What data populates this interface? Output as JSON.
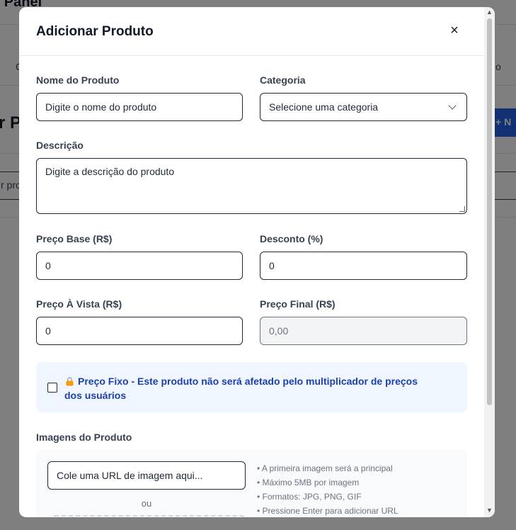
{
  "background": {
    "title": "n Panel",
    "nav_left": "C",
    "nav_right": "o",
    "heading": "r P",
    "button_label": "+   N",
    "search_text": "r pro"
  },
  "modal": {
    "title": "Adicionar Produto",
    "close_label": "×",
    "fields": {
      "name": {
        "label": "Nome do Produto",
        "placeholder": "Digite o nome do produto"
      },
      "category": {
        "label": "Categoria",
        "selected": "Selecione uma categoria"
      },
      "description": {
        "label": "Descrição",
        "placeholder": "Digite a descrição do produto"
      },
      "base_price": {
        "label": "Preço Base (R$)",
        "value": "0"
      },
      "discount": {
        "label": "Desconto (%)",
        "value": "0"
      },
      "cash_price": {
        "label": "Preço À Vista (R$)",
        "value": "0"
      },
      "final_price": {
        "label": "Preço Final (R$)",
        "value": "0,00"
      }
    },
    "fixed_price": {
      "text": "Preço Fixo - Este produto não será afetado pelo multiplicador de preços dos usuários",
      "checked": false
    },
    "images": {
      "label": "Imagens do Produto",
      "url_placeholder": "Cole uma URL de imagem aqui...",
      "or_text": "ou",
      "hints": [
        "• A primeira imagem será a principal",
        "• Máximo 5MB por imagem",
        "• Formatos: JPG, PNG, GIF",
        "• Pressione Enter para adicionar URL"
      ]
    }
  },
  "colors": {
    "accent": "#2563eb",
    "fixed_box_bg": "#eff6ff",
    "fixed_text": "#1e40af"
  }
}
